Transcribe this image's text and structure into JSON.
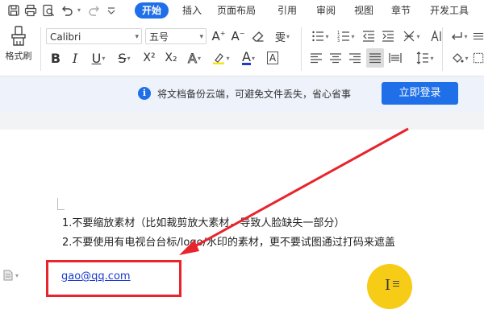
{
  "tabs": [
    {
      "label": "开始",
      "active": true
    },
    {
      "label": "插入"
    },
    {
      "label": "页面布局"
    },
    {
      "label": "引用"
    },
    {
      "label": "审阅"
    },
    {
      "label": "视图"
    },
    {
      "label": "章节"
    },
    {
      "label": "开发工具"
    }
  ],
  "quick_access": [
    "save-icon",
    "print-icon",
    "print-preview-icon",
    "undo-icon",
    "redo-icon",
    "customize-icon"
  ],
  "ribbon": {
    "format_painter_label": "格式刷",
    "font_name": "Calibri",
    "font_size": "五号",
    "font_buttons_row1": [
      "A⁺",
      "A⁻",
      "清除格式",
      "拼音"
    ],
    "font_buttons_row2": [
      "B",
      "I",
      "U",
      "S",
      "X²",
      "X₂",
      "A",
      "highlight",
      "A",
      "A"
    ]
  },
  "notification": {
    "icon": "i",
    "text": "将文档备份云端，可避免文件丢失，省心省事",
    "button": "立即登录"
  },
  "document": {
    "line1": "1.不要缩放素材（比如裁剪放大素材，导致人脸缺失一部分）",
    "line2": "2.不要使用有电视台台标/logo/水印的素材，更不要试图通过打码来遮盖",
    "email": "gao@qq.com"
  },
  "colors": {
    "accent": "#1f6fe8",
    "annotation_red": "#e8242c",
    "cursor_highlight": "#f6cc16",
    "notification_bg": "#eef3fb",
    "link": "#1a3ccf"
  }
}
